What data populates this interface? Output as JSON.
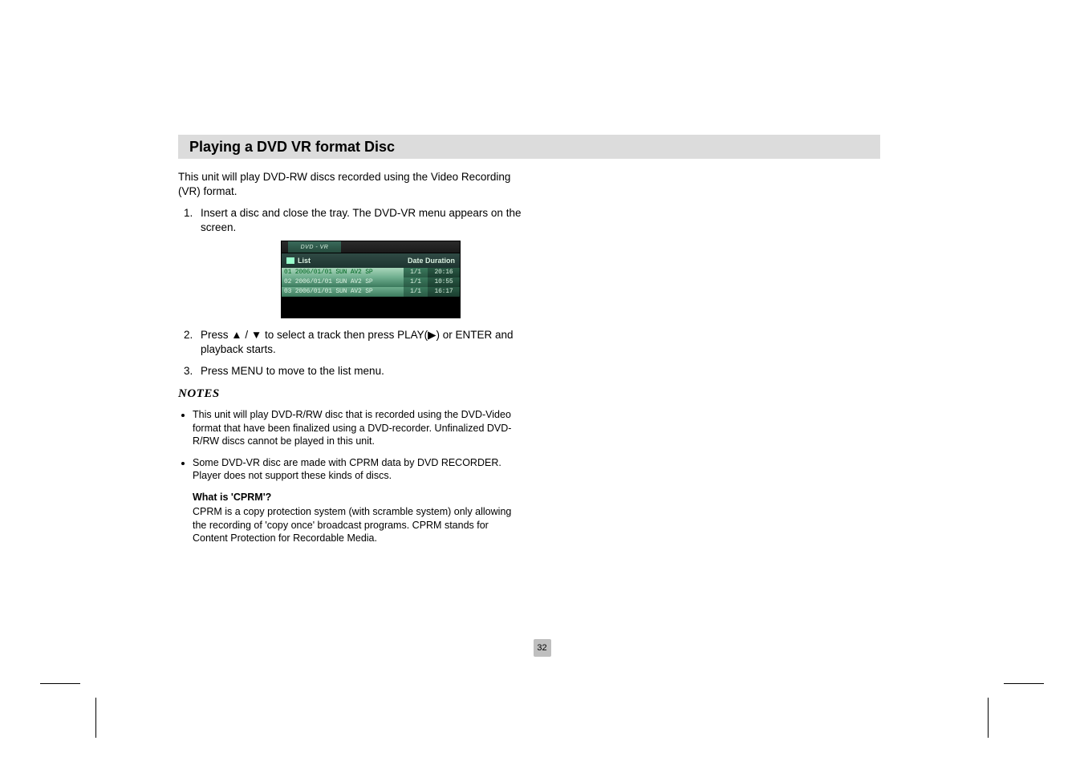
{
  "heading": "Playing a DVD VR format Disc",
  "intro": "This unit will play DVD-RW discs recorded using the Video Recording (VR) format.",
  "step1": "Insert a disc and close the tray. The DVD-VR menu appears on the screen.",
  "step2_a": "Press ",
  "step2_up": "▲",
  "step2_sep": " / ",
  "step2_down": "▼",
  "step2_b": " to select a track then press PLAY(",
  "step2_play": "▶",
  "step2_c": ") or ENTER and playback starts.",
  "step3": "Press MENU to move to the list menu.",
  "notes_heading": "NOTES",
  "note1": "This unit will play DVD-R/RW disc that is recorded using the DVD-Video format that have been finalized using a DVD-recorder. Unfinalized DVD-R/RW discs cannot be played in this unit.",
  "note2": "Some DVD-VR disc are made with CPRM data by DVD RECORDER. Player does not support these kinds of discs.",
  "cprm_q": "What is 'CPRM'?",
  "cprm_a": "CPRM is a copy protection system (with scramble system) only allowing the recording of 'copy once' broadcast programs. CPRM stands for Content Protection for Recordable Media.",
  "page_number": "32",
  "dvdvr": {
    "tab": "DVD - VR",
    "list_label": "List",
    "hdr_date": "Date",
    "hdr_duration": "Duration",
    "rows": [
      {
        "main": "01 2006/01/01 SUN  AV2   SP",
        "date": "1/1",
        "dur": "20:16"
      },
      {
        "main": "02 2006/01/01 SUN  AV2   SP",
        "date": "1/1",
        "dur": "10:55"
      },
      {
        "main": "03 2006/01/01 SUN  AV2   SP",
        "date": "1/1",
        "dur": "16:17"
      }
    ]
  }
}
